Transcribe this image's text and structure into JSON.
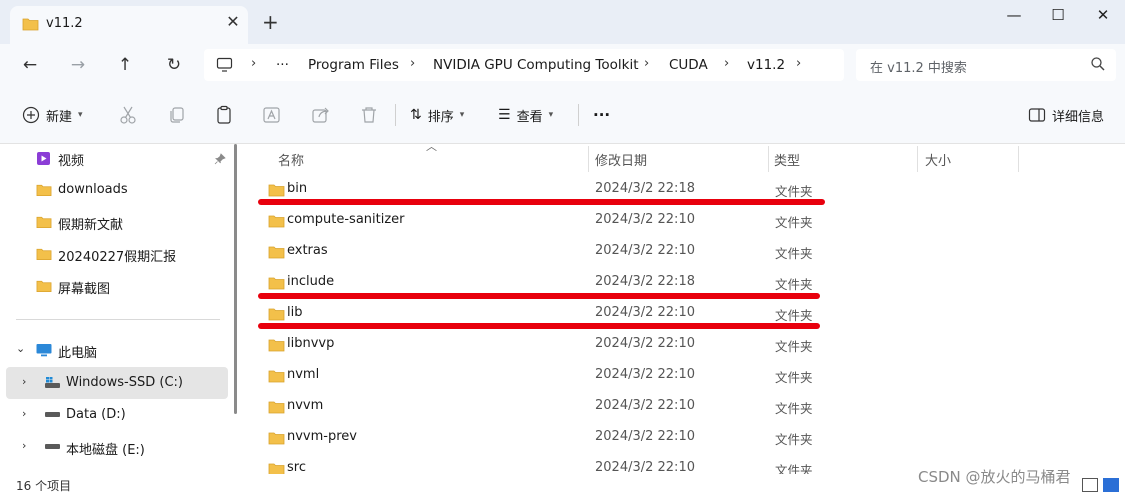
{
  "window": {
    "tab_title": "v11.2",
    "tab_close": "✕",
    "new_tab": "+",
    "minimize": "—",
    "maximize": "☐",
    "close": "✕"
  },
  "address": {
    "breadcrumbs": [
      "Program Files",
      "NVIDIA GPU Computing Toolkit",
      "CUDA",
      "v11.2"
    ],
    "ellipsis": "···",
    "separator": "›",
    "search_placeholder": "在 v11.2 中搜索"
  },
  "toolbar": {
    "new_label": "新建",
    "sort_label": "排序",
    "view_label": "查看",
    "more_label": "···",
    "details_label": "详细信息"
  },
  "sidebar": {
    "quick_items": [
      {
        "label": "视频",
        "icon": "video-folder-icon"
      },
      {
        "label": "downloads",
        "icon": "folder-icon"
      },
      {
        "label": "假期新文献",
        "icon": "folder-icon"
      },
      {
        "label": "20240227假期汇报",
        "icon": "folder-icon"
      },
      {
        "label": "屏幕截图",
        "icon": "folder-icon"
      }
    ],
    "this_pc": "此电脑",
    "drives": [
      {
        "label": "Windows-SSD (C:)",
        "selected": true
      },
      {
        "label": "Data (D:)",
        "selected": false
      },
      {
        "label": "本地磁盘 (E:)",
        "selected": false
      }
    ]
  },
  "columns": {
    "name": "名称",
    "modified": "修改日期",
    "type": "类型",
    "size": "大小"
  },
  "files": [
    {
      "name": "bin",
      "date": "2024/3/2 22:18",
      "type": "文件夹",
      "highlighted": true
    },
    {
      "name": "compute-sanitizer",
      "date": "2024/3/2 22:10",
      "type": "文件夹",
      "highlighted": false
    },
    {
      "name": "extras",
      "date": "2024/3/2 22:10",
      "type": "文件夹",
      "highlighted": false
    },
    {
      "name": "include",
      "date": "2024/3/2 22:18",
      "type": "文件夹",
      "highlighted": true
    },
    {
      "name": "lib",
      "date": "2024/3/2 22:10",
      "type": "文件夹",
      "highlighted": true
    },
    {
      "name": "libnvvp",
      "date": "2024/3/2 22:10",
      "type": "文件夹",
      "highlighted": false
    },
    {
      "name": "nvml",
      "date": "2024/3/2 22:10",
      "type": "文件夹",
      "highlighted": false
    },
    {
      "name": "nvvm",
      "date": "2024/3/2 22:10",
      "type": "文件夹",
      "highlighted": false
    },
    {
      "name": "nvvm-prev",
      "date": "2024/3/2 22:10",
      "type": "文件夹",
      "highlighted": false
    },
    {
      "name": "src",
      "date": "2024/3/2 22:10",
      "type": "文件夹",
      "highlighted": false
    }
  ],
  "status": {
    "item_count": "16 个项目"
  },
  "watermark": "CSDN @放火的马桶君",
  "colors": {
    "folder": "#f3c04a",
    "annotation": "#e8000d",
    "selection": "#e5e5e5"
  }
}
